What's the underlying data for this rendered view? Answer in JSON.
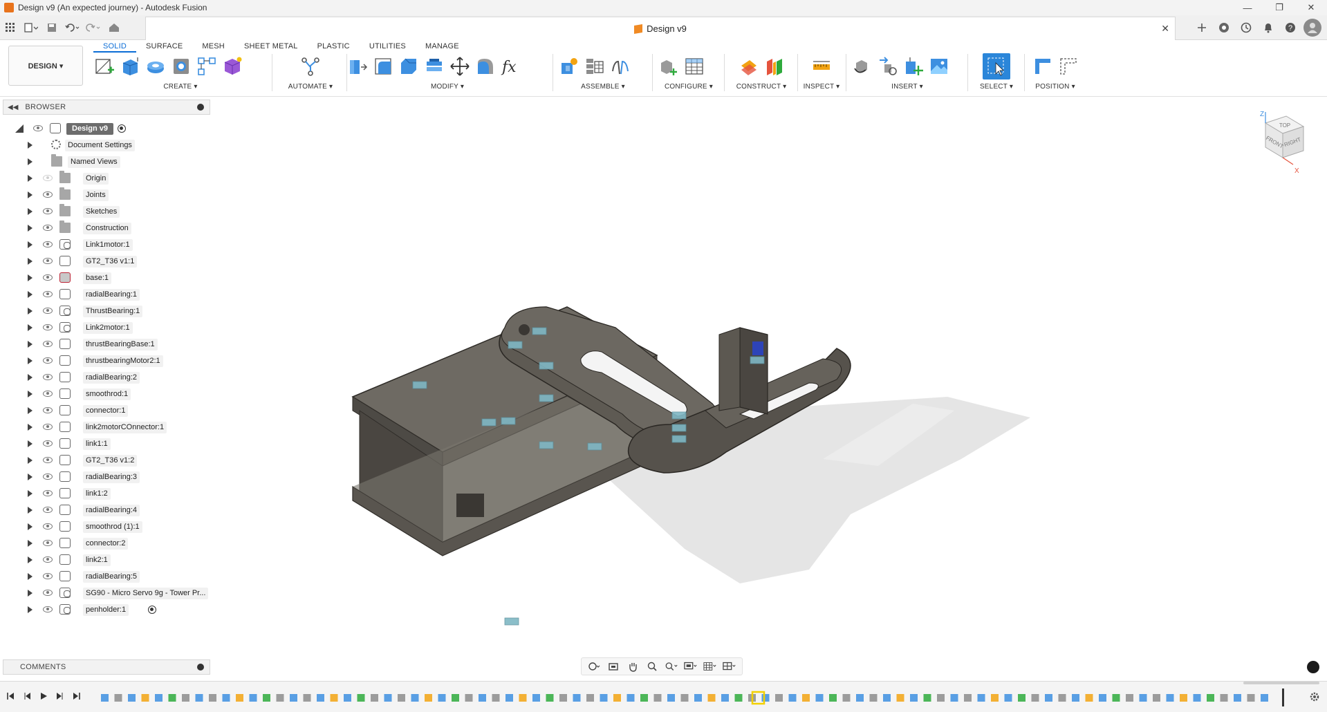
{
  "window": {
    "title": "Design v9 (An expected journey) - Autodesk Fusion",
    "controls": [
      "—",
      "❐",
      "✕"
    ]
  },
  "document_tab": {
    "title": "Design v9",
    "close": "✕"
  },
  "ribbon": {
    "workspace_button": "DESIGN ▾",
    "workspace_tabs": [
      "SOLID",
      "SURFACE",
      "MESH",
      "SHEET METAL",
      "PLASTIC",
      "UTILITIES",
      "MANAGE"
    ],
    "active_tab": "SOLID",
    "groups": [
      {
        "label": "CREATE ▾"
      },
      {
        "label": "AUTOMATE ▾"
      },
      {
        "label": "MODIFY ▾"
      },
      {
        "label": "ASSEMBLE ▾"
      },
      {
        "label": "CONFIGURE ▾"
      },
      {
        "label": "CONSTRUCT ▾"
      },
      {
        "label": "INSPECT ▾"
      },
      {
        "label": "INSERT ▾"
      },
      {
        "label": "SELECT ▾"
      },
      {
        "label": "POSITION ▾"
      }
    ],
    "fx_label": "fx"
  },
  "browser": {
    "header": "BROWSER",
    "root": "Design v9",
    "items": [
      {
        "label": "Document Settings",
        "icon": "gear-icon"
      },
      {
        "label": "Named Views",
        "icon": "folder-icon"
      },
      {
        "label": "Origin",
        "icon": "folder-icon"
      },
      {
        "label": "Joints",
        "icon": "folder-icon"
      },
      {
        "label": "Sketches",
        "icon": "folder-icon"
      },
      {
        "label": "Construction",
        "icon": "folder-icon"
      },
      {
        "label": "Link1motor:1",
        "icon": "linked-component-icon"
      },
      {
        "label": "GT2_T36 v1:1",
        "icon": "component-icon"
      },
      {
        "label": "base:1",
        "icon": "base-component-icon"
      },
      {
        "label": "radialBearing:1",
        "icon": "component-icon"
      },
      {
        "label": "ThrustBearing:1",
        "icon": "linked-component-icon"
      },
      {
        "label": "Link2motor:1",
        "icon": "linked-component-icon"
      },
      {
        "label": "thrustBearingBase:1",
        "icon": "component-icon"
      },
      {
        "label": "thrustbearingMotor2:1",
        "icon": "component-icon"
      },
      {
        "label": "radialBearing:2",
        "icon": "component-icon"
      },
      {
        "label": "smoothrod:1",
        "icon": "component-icon"
      },
      {
        "label": "connector:1",
        "icon": "component-icon"
      },
      {
        "label": "link2motorCOnnector:1",
        "icon": "component-icon"
      },
      {
        "label": "link1:1",
        "icon": "component-icon"
      },
      {
        "label": "GT2_T36 v1:2",
        "icon": "component-icon"
      },
      {
        "label": "radialBearing:3",
        "icon": "component-icon"
      },
      {
        "label": "link1:2",
        "icon": "component-icon"
      },
      {
        "label": "radialBearing:4",
        "icon": "component-icon"
      },
      {
        "label": "smoothrod (1):1",
        "icon": "component-icon"
      },
      {
        "label": "connector:2",
        "icon": "component-icon"
      },
      {
        "label": "link2:1",
        "icon": "component-icon"
      },
      {
        "label": "radialBearing:5",
        "icon": "component-icon"
      },
      {
        "label": "SG90 - Micro Servo 9g - Tower Pr...",
        "icon": "linked-component-icon"
      },
      {
        "label": "penholder:1",
        "icon": "linked-component-icon"
      }
    ]
  },
  "comments": {
    "header": "COMMENTS"
  },
  "viewcube": {
    "faces": [
      "TOP",
      "FRONT",
      "RIGHT"
    ],
    "axes": [
      "Z",
      "X"
    ]
  },
  "colors": {
    "accent": "#0a6cd6",
    "model_body": "#5b5750",
    "model_top": "#6a665f",
    "shadow": "#c9c9c9",
    "fusion_orange": "#f08a24"
  }
}
